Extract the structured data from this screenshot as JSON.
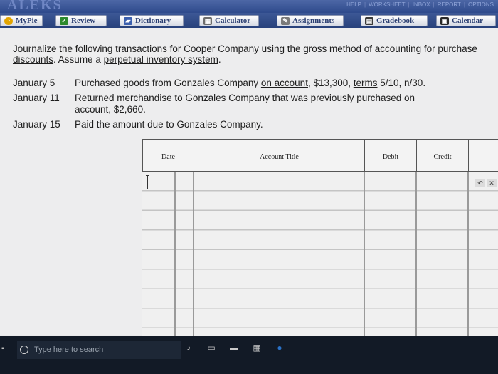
{
  "header": {
    "logo": "ALEKS",
    "links": [
      "HELP",
      "WORKSHEET",
      "INBOX",
      "REPORT",
      "OPTIONS"
    ]
  },
  "tabs": [
    {
      "label": "MyPie",
      "icon": "pie-chart-icon",
      "color": "#e2a400"
    },
    {
      "label": "Review",
      "icon": "checkmark-icon",
      "color": "#2d8a2d"
    },
    {
      "label": "Dictionary",
      "icon": "book-icon",
      "color": "#3b5fae"
    },
    {
      "label": "Calculator",
      "icon": "calculator-icon",
      "color": "#6e6e6e"
    },
    {
      "label": "Assignments",
      "icon": "pencil-icon",
      "color": "#7a7a7a"
    },
    {
      "label": "Gradebook",
      "icon": "gradebook-icon",
      "color": "#3a3a3a"
    },
    {
      "label": "Calendar",
      "icon": "calendar-icon",
      "color": "#2a2a2a"
    }
  ],
  "question": {
    "part1": "Journalize the following transactions for Cooper Company using the ",
    "link1": "gross method",
    "part2": " of accounting for ",
    "link2": "purchase discounts",
    "part3": ". Assume a ",
    "link3": "perpetual inventory system",
    "part4": "."
  },
  "transactions": [
    {
      "date": "January 5",
      "pre": "Purchased goods from Gonzales Company ",
      "link": "on account",
      "mid": ", $13,300, ",
      "link2": "terms",
      "post": " 5/10, n/30."
    },
    {
      "date": "January 11",
      "text": "Returned merchandise to Gonzales Company that was previously purchased on account, $2,660."
    },
    {
      "date": "January 15",
      "text": "Paid the amount due to Gonzales Company."
    }
  ],
  "journal": {
    "columns": [
      "Date",
      "Account Title",
      "Debit",
      "Credit"
    ],
    "row_count": 9
  },
  "taskbar": {
    "search_placeholder": "Type here to search"
  },
  "colors": {
    "header_blue": "#2e4a8c",
    "tab_text": "#2b3f72",
    "taskbar": "#121a26"
  }
}
